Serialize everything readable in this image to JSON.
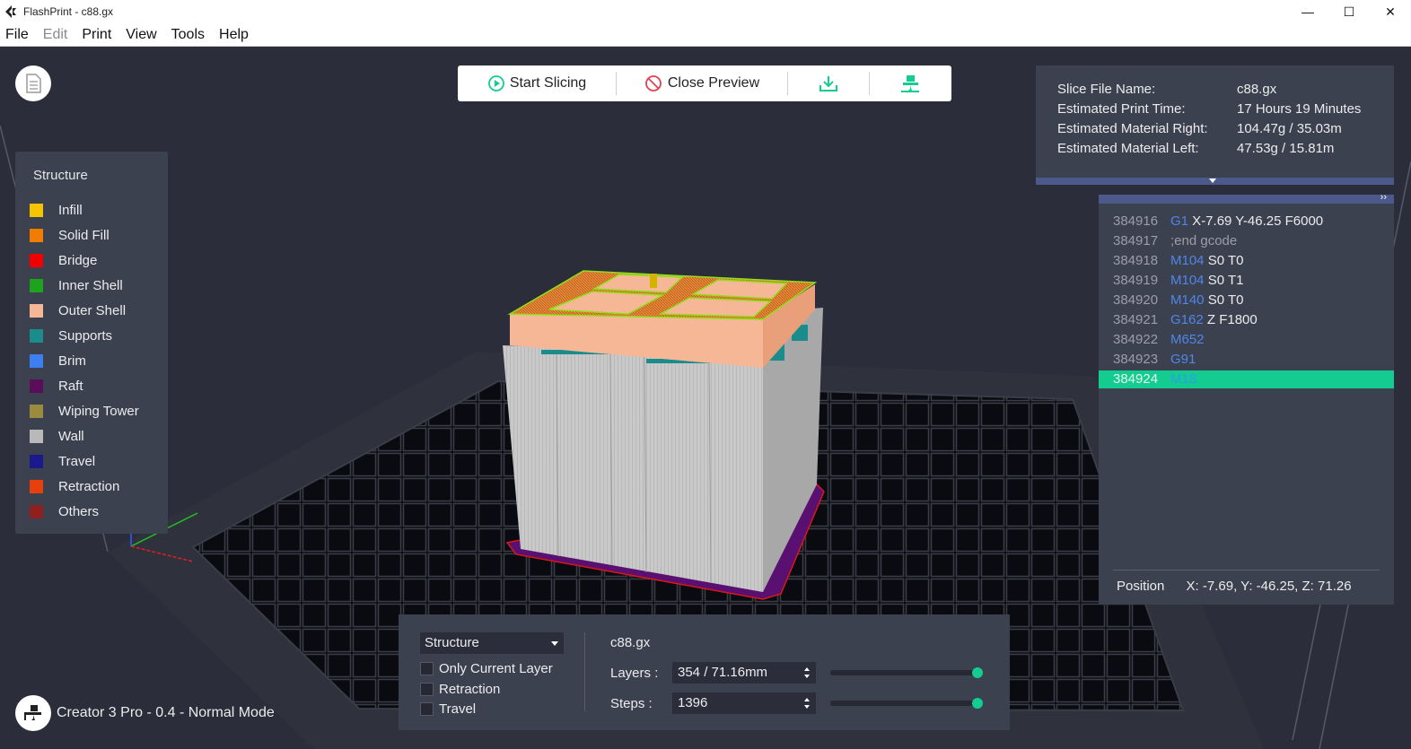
{
  "window": {
    "title": "FlashPrint - c88.gx",
    "controls": {
      "minimize": "—",
      "maximize": "☐",
      "close": "✕"
    }
  },
  "menu": {
    "items": [
      {
        "label": "File",
        "enabled": true
      },
      {
        "label": "Edit",
        "enabled": false
      },
      {
        "label": "Print",
        "enabled": true
      },
      {
        "label": "View",
        "enabled": true
      },
      {
        "label": "Tools",
        "enabled": true
      },
      {
        "label": "Help",
        "enabled": true
      }
    ]
  },
  "toolbar": {
    "start_slicing": "Start Slicing",
    "close_preview": "Close Preview",
    "export_icon": "download-icon",
    "print_icon": "print-icon"
  },
  "legend": {
    "title": "Structure",
    "items": [
      {
        "label": "Infill",
        "color": "#f5c400"
      },
      {
        "label": "Solid Fill",
        "color": "#f07c00"
      },
      {
        "label": "Bridge",
        "color": "#f00000"
      },
      {
        "label": "Inner Shell",
        "color": "#1fa31f"
      },
      {
        "label": "Outer Shell",
        "color": "#f6b797"
      },
      {
        "label": "Supports",
        "color": "#1a8c8c"
      },
      {
        "label": "Brim",
        "color": "#3d7ef0"
      },
      {
        "label": "Raft",
        "color": "#5a0e5a"
      },
      {
        "label": "Wiping Tower",
        "color": "#9a8c3c"
      },
      {
        "label": "Wall",
        "color": "#b9b9b9"
      },
      {
        "label": "Travel",
        "color": "#1a1a8c"
      },
      {
        "label": "Retraction",
        "color": "#e8400c"
      },
      {
        "label": "Others",
        "color": "#8f2020"
      }
    ]
  },
  "slice_info": {
    "rows": [
      {
        "label": "Slice File Name:",
        "value": "c88.gx"
      },
      {
        "label": "Estimated Print Time:",
        "value": "17 Hours 19 Minutes"
      },
      {
        "label": "Estimated Material Right:",
        "value": "104.47g / 35.03m"
      },
      {
        "label": "Estimated Material Left:",
        "value": "47.53g / 15.81m"
      }
    ]
  },
  "gcode": {
    "expand_glyph": "››",
    "lines": [
      {
        "num": "384916",
        "cmd": "G1",
        "rest": " X-7.69 Y-46.25 F6000"
      },
      {
        "num": "384917",
        "cmd": "",
        "comment": ";end gcode"
      },
      {
        "num": "384918",
        "cmd": "M104",
        "rest": " S0 T0"
      },
      {
        "num": "384919",
        "cmd": "M104",
        "rest": " S0 T1"
      },
      {
        "num": "384920",
        "cmd": "M140",
        "rest": " S0 T0"
      },
      {
        "num": "384921",
        "cmd": "G162",
        "rest": " Z F1800"
      },
      {
        "num": "384922",
        "cmd": "M652",
        "rest": ""
      },
      {
        "num": "384923",
        "cmd": "G91",
        "rest": ""
      },
      {
        "num": "384924",
        "cmd": "M18",
        "rest": "",
        "active": true
      }
    ],
    "position_label": "Position",
    "position_value": "X: -7.69, Y: -46.25, Z: 71.26"
  },
  "controls": {
    "structure_select": "Structure",
    "checkboxes": [
      {
        "label": "Only Current Layer",
        "checked": false
      },
      {
        "label": "Retraction",
        "checked": false
      },
      {
        "label": "Travel",
        "checked": false
      }
    ],
    "file_name": "c88.gx",
    "layers_label": "Layers :",
    "layers_value": "354 / 71.16mm",
    "layers_fraction": 1.0,
    "steps_label": "Steps :",
    "steps_value": "1396",
    "steps_fraction": 1.0
  },
  "printer": {
    "label": "Creator 3 Pro - 0.4 - Normal Mode"
  },
  "colors": {
    "accent": "#14cc8f",
    "panel": "#3c4150",
    "viewport": "#2b2d3a"
  }
}
